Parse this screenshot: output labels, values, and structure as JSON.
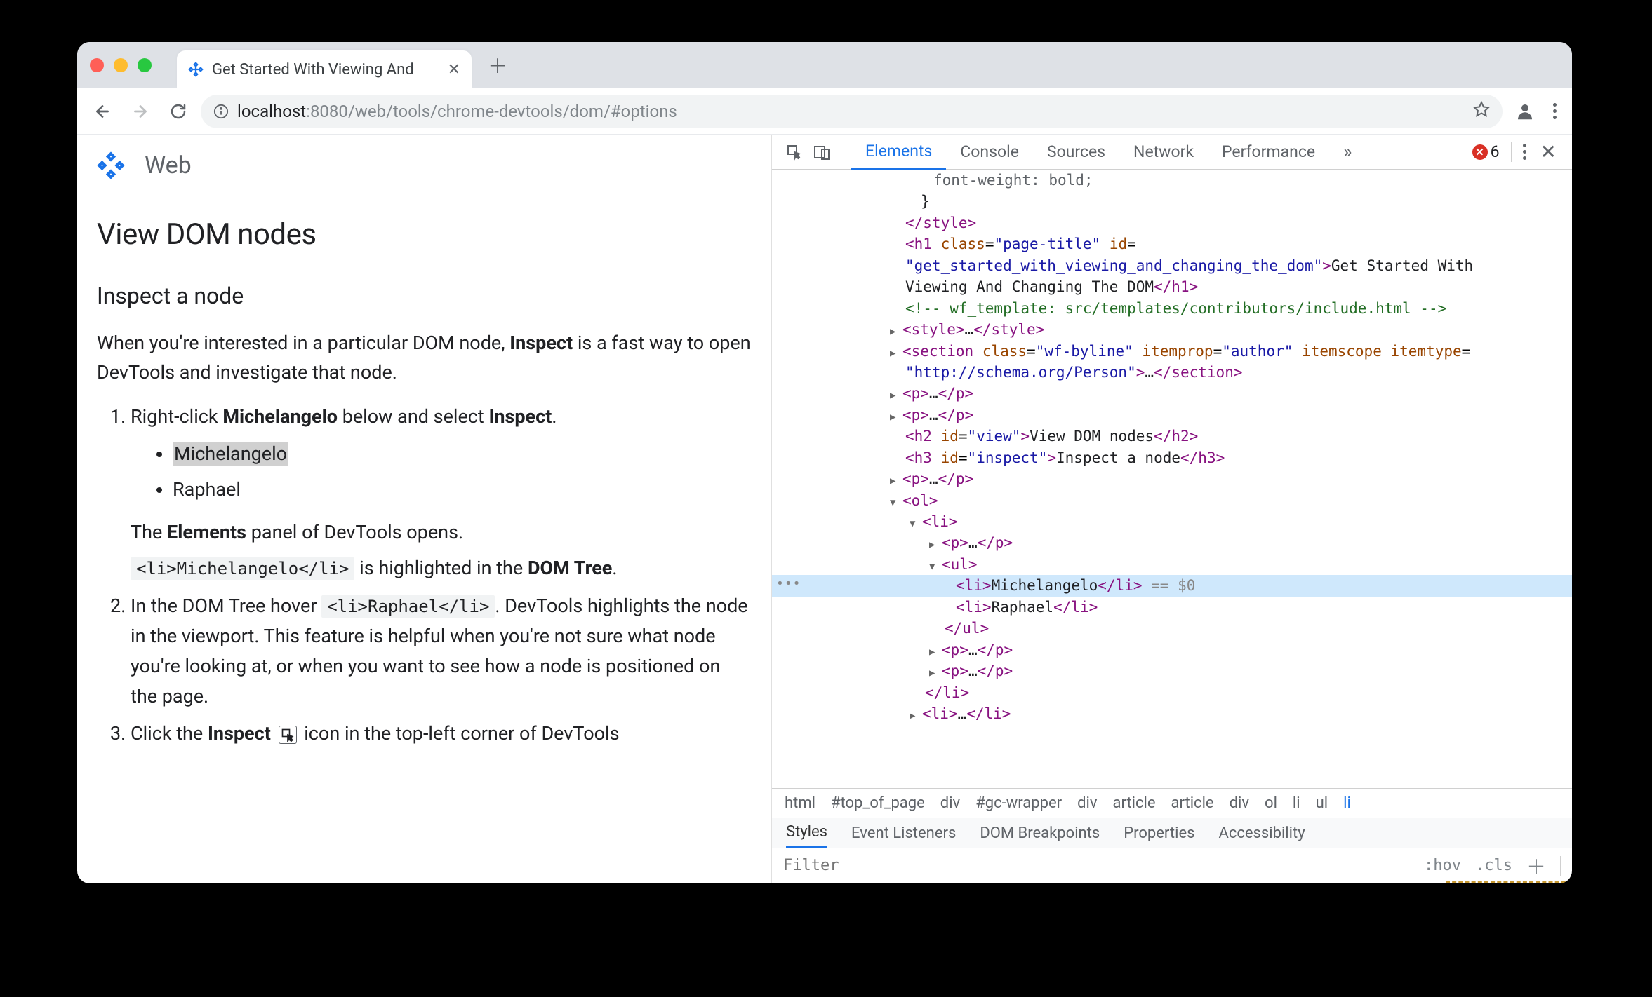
{
  "chrome": {
    "tab_title": "Get Started With Viewing And ",
    "url_host_pre": "localhost",
    "url_host_port": ":8080",
    "url_path": "/web/tools/chrome-devtools/dom/#options"
  },
  "page": {
    "site_name": "Web",
    "heading": "View DOM nodes",
    "subheading": "Inspect a node",
    "intro_pre": "When you're interested in a particular DOM node, ",
    "intro_bold": "Inspect",
    "intro_post": " is a fast way to open DevTools and investigate that node.",
    "step1_pre": "Right-click ",
    "step1_b1": "Michelangelo",
    "step1_mid": " below and select ",
    "step1_b2": "Inspect",
    "step1_post": ".",
    "bullet1": "Michelangelo",
    "bullet2": "Raphael",
    "step1_note_pre": "The ",
    "step1_note_b": "Elements",
    "step1_note_post": " panel of DevTools opens.",
    "step1_code": "<li>Michelangelo</li>",
    "step1_after_code_pre": " is highlighted in the ",
    "step1_after_code_b": "DOM Tree",
    "step1_after_code_post": ".",
    "step2_pre": "In the DOM Tree hover ",
    "step2_code": "<li>Raphael</li>",
    "step2_post": ". DevTools highlights the node in the viewport. This feature is helpful when you're not sure what node you're looking at, or when you want to see how a node is positioned on the page.",
    "step3_pre": "Click the ",
    "step3_b": "Inspect",
    "step3_post": " icon in the top-left corner of DevTools"
  },
  "devtools": {
    "tabs": [
      "Elements",
      "Console",
      "Sources",
      "Network",
      "Performance"
    ],
    "overflow": "»",
    "error_count": "6",
    "crumbs": [
      "html",
      "#top_of_page",
      "div",
      "#gc-wrapper",
      "div",
      "article",
      "article",
      "div",
      "ol",
      "li",
      "ul",
      "li"
    ],
    "styles_tabs": [
      "Styles",
      "Event Listeners",
      "DOM Breakpoints",
      "Properties",
      "Accessibility"
    ],
    "filter_placeholder": "Filter",
    "hov": ":hov",
    "cls": ".cls",
    "src": {
      "fontweight": "font-weight: bold;",
      "brace": "}",
      "style_close": "</style>",
      "h1_open": "<h1",
      "h1_class_attr": "class",
      "h1_class_val": "page-title",
      "h1_id_attr": "id",
      "h1_id_val": "get_started_with_viewing_and_changing_the_dom",
      "h1_text": "Get Started With Viewing And Changing The DOM",
      "h1_close": "</h1>",
      "comment": "<!-- wf_template: src/templates/contributors/include.html -->",
      "style2": "<style>…</style>",
      "section_tag": "section",
      "section_class_attr": "class",
      "section_class_val": "wf-byline",
      "section_itemprop_attr": "itemprop",
      "section_itemprop_val": "author",
      "section_itemscope": "itemscope",
      "section_itemtype_attr": "itemtype",
      "section_itemtype_val": "http://schema.org/Person",
      "section_close": "…</section>",
      "p_collapsed": "<p>…</p>",
      "h2_tag": "h2",
      "h2_id_attr": "id",
      "h2_id_val": "view",
      "h2_text": "View DOM nodes",
      "h3_tag": "h3",
      "h3_id_attr": "id",
      "h3_id_val": "inspect",
      "h3_text": "Inspect a node",
      "ol_open": "<ol>",
      "li_open": "<li>",
      "ul_open": "<ul>",
      "li_name1": "Michelangelo",
      "li_name2": "Raphael",
      "eq0": " == $0",
      "ul_close": "</ul>",
      "li_close": "</li>",
      "li_collapsed": "<li>…</li>"
    }
  }
}
